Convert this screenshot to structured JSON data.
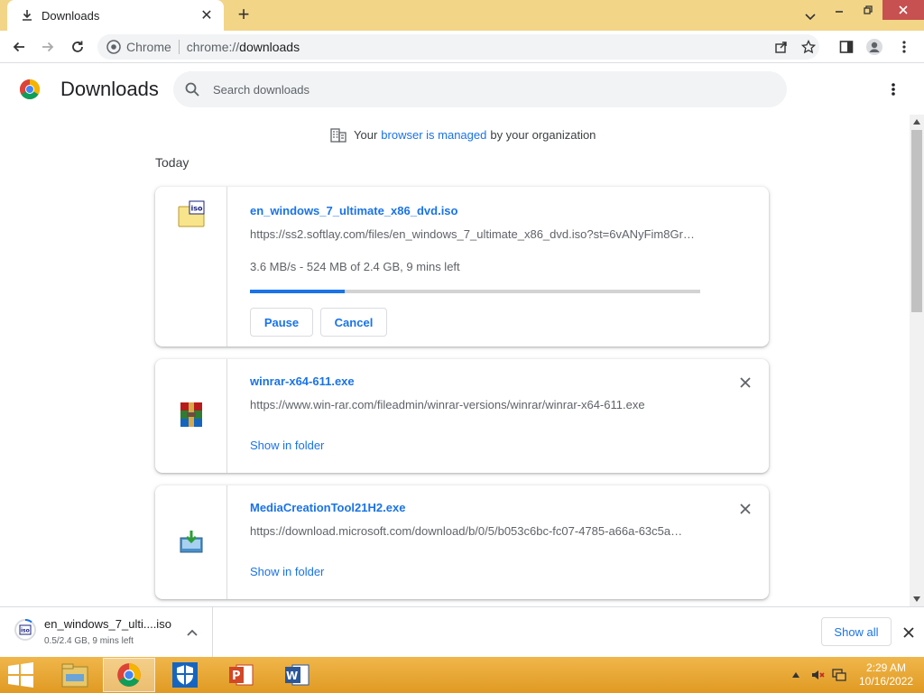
{
  "tab": {
    "title": "Downloads",
    "close": "✕",
    "new_tab": "+"
  },
  "window": {
    "minimize": "⌄",
    "min2": "—",
    "restore": "❐",
    "close": "✕"
  },
  "omnibox": {
    "site_label": "Chrome",
    "url_scheme": "chrome://",
    "url_path": "downloads"
  },
  "header": {
    "title": "Downloads",
    "search_placeholder": "Search downloads"
  },
  "managed": {
    "prefix": "Your",
    "link": "browser is managed",
    "suffix": "by your organization"
  },
  "section": {
    "date": "Today"
  },
  "downloads": [
    {
      "name": "en_windows_7_ultimate_x86_dvd.iso",
      "url": "https://ss2.softlay.com/files/en_windows_7_ultimate_x86_dvd.iso?st=6vANyFim8Gr…",
      "status": "3.6 MB/s - 524 MB of 2.4 GB, 9 mins left",
      "progress": 0.21,
      "pause_label": "Pause",
      "cancel_label": "Cancel"
    },
    {
      "name": "winrar-x64-611.exe",
      "url": "https://www.win-rar.com/fileadmin/winrar-versions/winrar/winrar-x64-611.exe",
      "action": "Show in folder"
    },
    {
      "name": "MediaCreationTool21H2.exe",
      "url": "https://download.microsoft.com/download/b/0/5/b053c6bc-fc07-4785-a66a-63c5a…",
      "action": "Show in folder"
    }
  ],
  "shelf": {
    "name": "en_windows_7_ulti....iso",
    "status": "0.5/2.4 GB, 9 mins left",
    "show_all": "Show all"
  },
  "taskbar": {
    "time": "2:29 AM",
    "date": "10/16/2022"
  },
  "colors": {
    "accent": "#1a73e8",
    "tabstrip": "#f3d588",
    "taskbar": "#e8a83a"
  }
}
